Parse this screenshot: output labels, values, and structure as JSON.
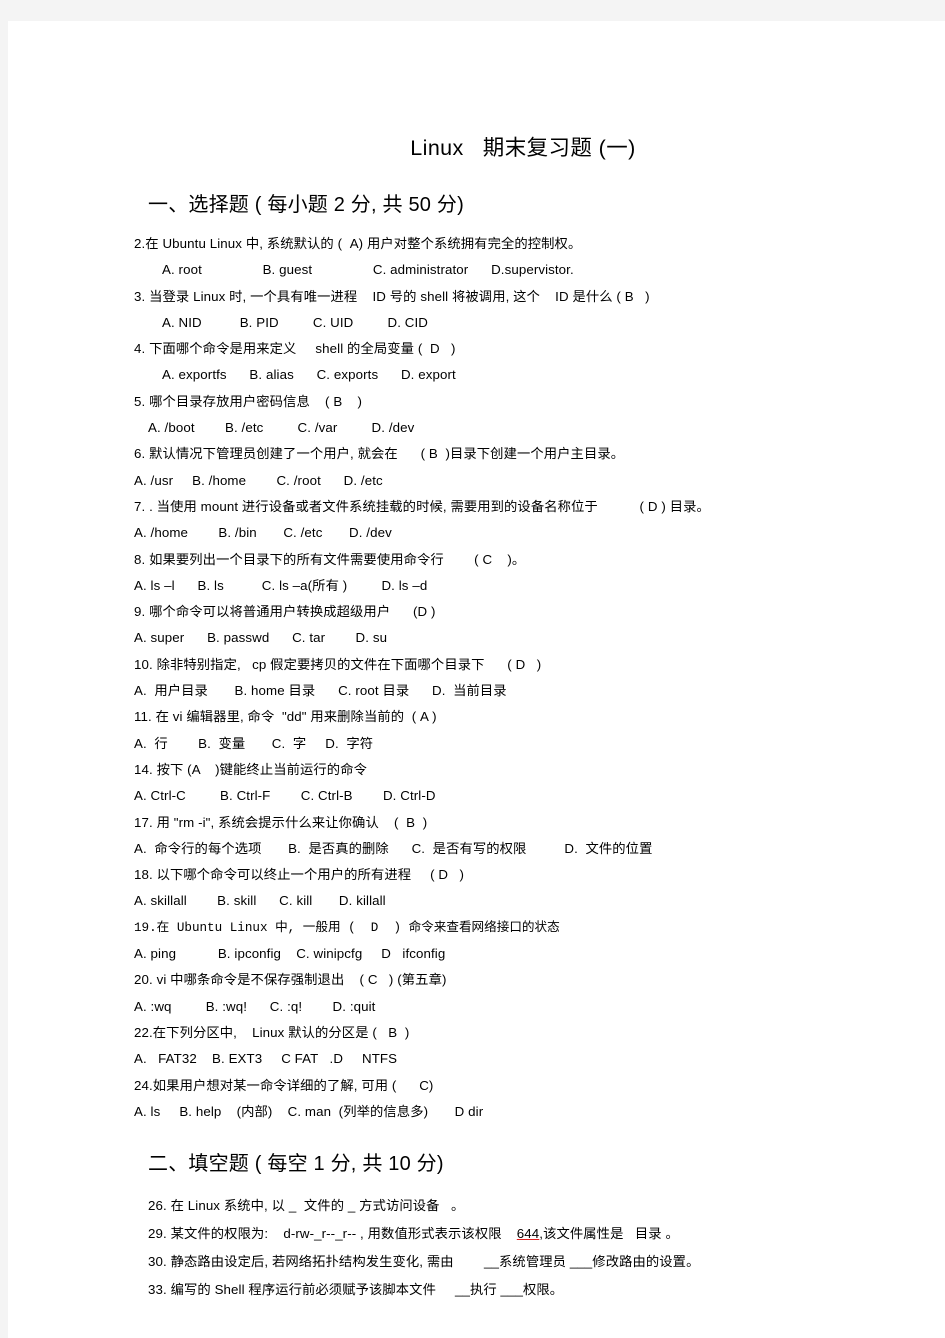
{
  "document": {
    "title": "Linux   期末复习题 (一)",
    "sections": [
      {
        "heading": "一、选择题 ( 每小题 2 分, 共 50 分)",
        "lines": [
          {
            "text": "2.在 Ubuntu Linux 中, 系统默认的 (  A) 用户对整个系统拥有完全的控制权。",
            "indent": 0
          },
          {
            "text": "A. root                B. guest                C. administrator      D.supervistor.",
            "indent": 2
          },
          {
            "text": "3. 当登录 Linux 时, 一个具有唯一进程    ID 号的 shell 将被调用, 这个    ID 是什么 ( B   )",
            "indent": 0
          },
          {
            "text": "A. NID          B. PID         C. UID         D. CID",
            "indent": 2
          },
          {
            "text": "4. 下面哪个命令是用来定义     shell 的全局变量 (  D   )",
            "indent": 0
          },
          {
            "text": "A. exportfs      B. alias      C. exports      D. export",
            "indent": 2
          },
          {
            "text": "5. 哪个目录存放用户密码信息    ( B    )",
            "indent": 0
          },
          {
            "text": "A. /boot        B. /etc         C. /var         D. /dev",
            "indent": 1
          },
          {
            "text": "6. 默认情况下管理员创建了一个用户, 就会在      ( B  )目录下创建一个用户主目录。",
            "indent": 0
          },
          {
            "text": "A. /usr     B. /home        C. /root      D. /etc",
            "indent": 0
          },
          {
            "text": "7. . 当使用 mount 进行设备或者文件系统挂载的时候, 需要用到的设备名称位于           ( D ) 目录。",
            "indent": 0
          },
          {
            "text": "A. /home        B. /bin       C. /etc       D. /dev",
            "indent": 0
          },
          {
            "text": "8. 如果要列出一个目录下的所有文件需要使用命令行        ( C    )。",
            "indent": 0
          },
          {
            "text": "A. ls –l      B. ls          C. ls –a(所有 )         D. ls –d",
            "indent": 0
          },
          {
            "text": "9. 哪个命令可以将普通用户转换成超级用户      (D )",
            "indent": 0
          },
          {
            "text": "A. super      B. passwd      C. tar        D. su",
            "indent": 0
          },
          {
            "text": "10. 除非特别指定,   cp 假定要拷贝的文件在下面哪个目录下      ( D   )",
            "indent": 0
          },
          {
            "text": "A.  用户目录       B. home 目录      C. root 目录      D.  当前目录",
            "indent": 0
          },
          {
            "text": "11. 在 vi 编辑器里, 命令  \"dd\" 用来删除当前的  ( A )",
            "indent": 0
          },
          {
            "text": "A.  行        B.  变量       C.  字     D.  字符",
            "indent": 0
          },
          {
            "text": "14. 按下 (A    )键能终止当前运行的命令",
            "indent": 0
          },
          {
            "text": "A. Ctrl-C         B. Ctrl-F        C. Ctrl-B        D. Ctrl-D",
            "indent": 0
          },
          {
            "text": "17. 用 \"rm -i\", 系统会提示什么来让你确认    (  B  )",
            "indent": 0
          },
          {
            "text": "A.  命令行的每个选项       B.  是否真的删除      C.  是否有写的权限          D.  文件的位置",
            "indent": 0
          },
          {
            "text": "18. 以下哪个命令可以终止一个用户的所有进程     ( D   )",
            "indent": 0
          },
          {
            "text": "A. skillall        B. skill      C. kill       D. killall",
            "indent": 0
          },
          {
            "text": "19.在 Ubuntu Linux 中, 一般用 (  D  ) 命令来查看网络接口的状态",
            "indent": 0,
            "mono": true
          },
          {
            "text": "A. ping           B. ipconfig    C. winipcfg     D   ifconfig",
            "indent": 0
          },
          {
            "text": "20. vi 中哪条命令是不保存强制退出    ( C   ) (第五章)",
            "indent": 0
          },
          {
            "text": "A. :wq         B. :wq!      C. :q!        D. :quit",
            "indent": 0
          },
          {
            "text": "22.在下列分区中,    Linux 默认的分区是 (   B  )",
            "indent": 0
          },
          {
            "text": "A.   FAT32    B. EXT3     C FAT   .D     NTFS",
            "indent": 0
          },
          {
            "text": "24.如果用户想对某一命令详细的了解, 可用 (      C)",
            "indent": 0
          },
          {
            "text": "A. ls     B. help    (内部)    C. man  (列举的信息多)       D dir",
            "indent": 0
          }
        ]
      }
    ],
    "fill_section": {
      "heading": "二、填空题 ( 每空 1 分, 共 10 分)",
      "lines": [
        {
          "pre": "26. 在 Linux 系统中, 以 _  文件的 _ 方式访问设备   。",
          "spell": "",
          "post": ""
        },
        {
          "pre": "29. 某文件的权限为:    d-rw-_r--_r-- , 用数值形式表示该权限    ",
          "spell": "644",
          "post": ",该文件属性是   目录 。"
        },
        {
          "pre": "30. 静态路由设定后, 若网络拓扑结构发生变化, 需由        __系统管理员 ___修改路由的设置。",
          "spell": "",
          "post": ""
        },
        {
          "pre": "33. 编写的 Shell 程序运行前必须赋予该脚本文件     __执行 ___权限。",
          "spell": "",
          "post": ""
        }
      ]
    }
  }
}
